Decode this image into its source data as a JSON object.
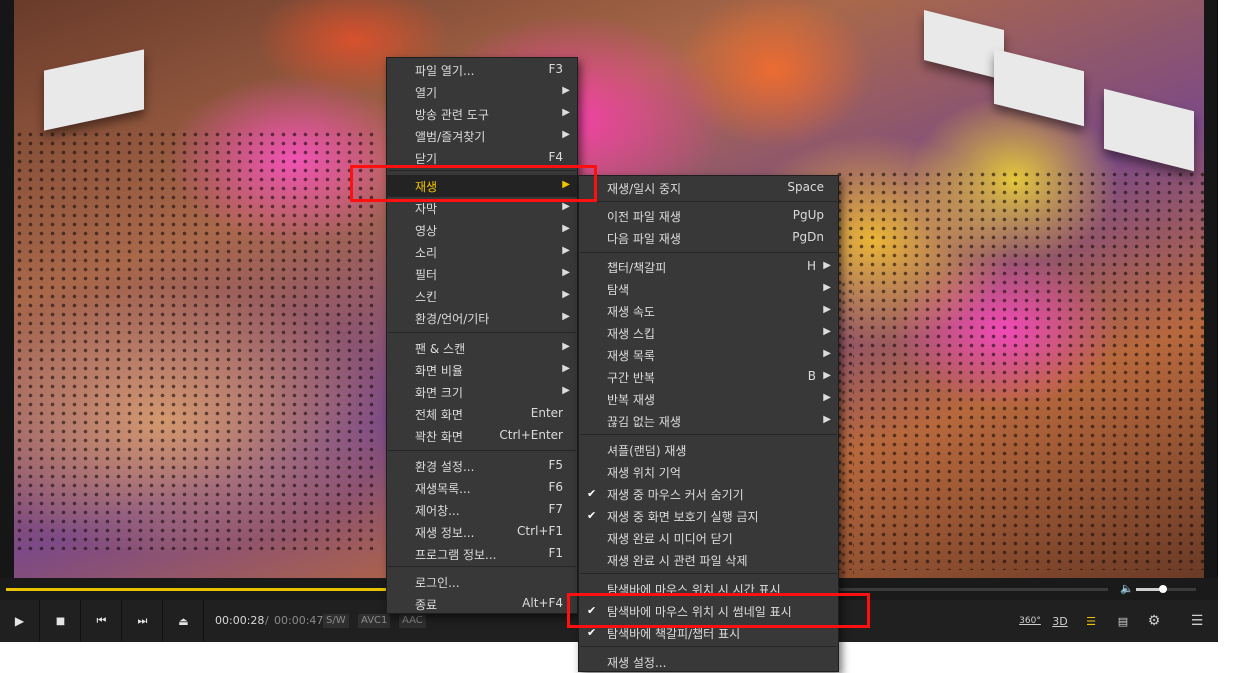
{
  "player": {
    "elapsed": "00:00:28",
    "time_sep": "/",
    "duration": "00:00:47",
    "tag_sw": "S/W",
    "tag_codec": "AVC1",
    "tag_audio": "AAC",
    "seek_progress": 0.6,
    "volume_level": 0.45,
    "btn_360": "360°",
    "btn_3d": "3D",
    "accent_color": "#e9c300"
  },
  "main_menu": {
    "items": [
      {
        "label": "파일 열기...",
        "shortcut": "F3",
        "submenu": false
      },
      {
        "label": "열기",
        "shortcut": "",
        "submenu": true
      },
      {
        "label": "방송 관련 도구",
        "shortcut": "",
        "submenu": true
      },
      {
        "label": "앨범/즐겨찾기",
        "shortcut": "",
        "submenu": true
      },
      {
        "label": "닫기",
        "shortcut": "F4",
        "submenu": false
      },
      {
        "label": "재생",
        "shortcut": "",
        "submenu": true
      },
      {
        "label": "자막",
        "shortcut": "",
        "submenu": true
      },
      {
        "label": "영상",
        "shortcut": "",
        "submenu": true
      },
      {
        "label": "소리",
        "shortcut": "",
        "submenu": true
      },
      {
        "label": "필터",
        "shortcut": "",
        "submenu": true
      },
      {
        "label": "스킨",
        "shortcut": "",
        "submenu": true
      },
      {
        "label": "환경/언어/기타",
        "shortcut": "",
        "submenu": true
      },
      {
        "label": "팬 & 스캔",
        "shortcut": "",
        "submenu": true
      },
      {
        "label": "화면 비율",
        "shortcut": "",
        "submenu": true
      },
      {
        "label": "화면 크기",
        "shortcut": "",
        "submenu": true
      },
      {
        "label": "전체 화면",
        "shortcut": "Enter",
        "submenu": false
      },
      {
        "label": "꽉찬 화면",
        "shortcut": "Ctrl+Enter",
        "submenu": false
      },
      {
        "label": "환경 설정...",
        "shortcut": "F5",
        "submenu": false
      },
      {
        "label": "재생목록...",
        "shortcut": "F6",
        "submenu": false
      },
      {
        "label": "제어창...",
        "shortcut": "F7",
        "submenu": false
      },
      {
        "label": "재생 정보...",
        "shortcut": "Ctrl+F1",
        "submenu": false
      },
      {
        "label": "프로그램 정보...",
        "shortcut": "F1",
        "submenu": false
      },
      {
        "label": "로그인...",
        "shortcut": "",
        "submenu": false
      },
      {
        "label": "종료",
        "shortcut": "Alt+F4",
        "submenu": false
      }
    ]
  },
  "play_menu": {
    "items": [
      {
        "label": "재생/일시 중지",
        "shortcut": "Space",
        "submenu": false,
        "checked": false
      },
      {
        "label": "이전 파일 재생",
        "shortcut": "PgUp",
        "submenu": false,
        "checked": false
      },
      {
        "label": "다음 파일 재생",
        "shortcut": "PgDn",
        "submenu": false,
        "checked": false
      },
      {
        "label": "챕터/책갈피",
        "shortcut": "H",
        "submenu": true,
        "checked": false
      },
      {
        "label": "탐색",
        "shortcut": "",
        "submenu": true,
        "checked": false
      },
      {
        "label": "재생 속도",
        "shortcut": "",
        "submenu": true,
        "checked": false
      },
      {
        "label": "재생 스킵",
        "shortcut": "",
        "submenu": true,
        "checked": false
      },
      {
        "label": "재생 목록",
        "shortcut": "",
        "submenu": true,
        "checked": false
      },
      {
        "label": "구간 반복",
        "shortcut": "B",
        "submenu": true,
        "checked": false
      },
      {
        "label": "반복 재생",
        "shortcut": "",
        "submenu": true,
        "checked": false
      },
      {
        "label": "끊김 없는 재생",
        "shortcut": "",
        "submenu": true,
        "checked": false
      },
      {
        "label": "셔플(랜덤) 재생",
        "shortcut": "",
        "submenu": false,
        "checked": false
      },
      {
        "label": "재생 위치 기억",
        "shortcut": "",
        "submenu": false,
        "checked": false
      },
      {
        "label": "재생 중 마우스 커서 숨기기",
        "shortcut": "",
        "submenu": false,
        "checked": true
      },
      {
        "label": "재생 중 화면 보호기 실행 금지",
        "shortcut": "",
        "submenu": false,
        "checked": true
      },
      {
        "label": "재생 완료 시 미디어 닫기",
        "shortcut": "",
        "submenu": false,
        "checked": false
      },
      {
        "label": "재생 완료 시 관련 파일 삭제",
        "shortcut": "",
        "submenu": false,
        "checked": false
      },
      {
        "label": "탐색바에 마우스 위치 시 시간 표시",
        "shortcut": "",
        "submenu": false,
        "checked": false
      },
      {
        "label": "탐색바에 마우스 위치 시 썸네일 표시",
        "shortcut": "",
        "submenu": false,
        "checked": true
      },
      {
        "label": "탐색바에 책갈피/챕터 표시",
        "shortcut": "",
        "submenu": false,
        "checked": true
      },
      {
        "label": "재생 설정...",
        "shortcut": "",
        "submenu": false,
        "checked": false
      }
    ]
  },
  "icons": {
    "play": "play-icon",
    "stop": "stop-icon",
    "prev": "previous-icon",
    "next": "next-icon",
    "eject": "eject-icon",
    "volume": "volume-icon",
    "playlist": "playlist-search-icon",
    "notes": "notes-icon",
    "settings": "gear-icon",
    "menu": "hamburger-menu-icon",
    "submenu": "submenu-arrow-icon",
    "check": "check-icon"
  }
}
